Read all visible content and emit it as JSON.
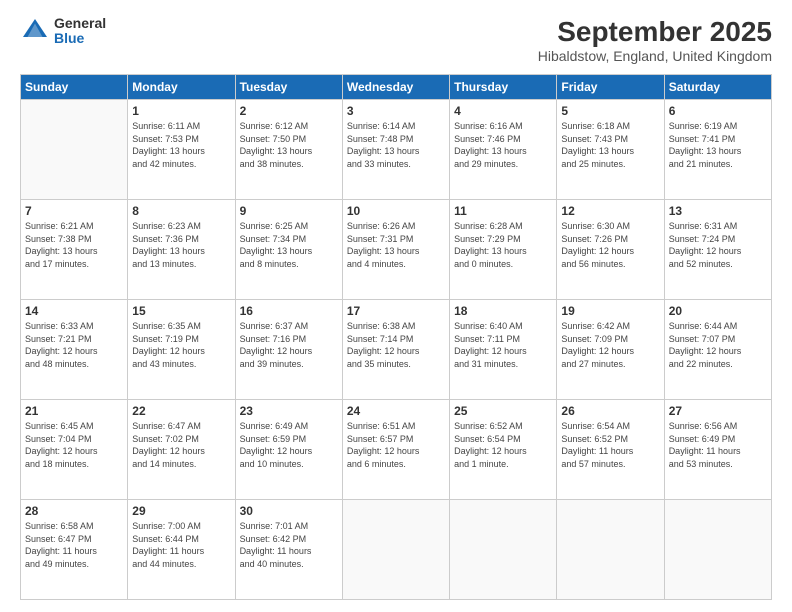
{
  "header": {
    "logo": {
      "general": "General",
      "blue": "Blue"
    },
    "title": "September 2025",
    "subtitle": "Hibaldstow, England, United Kingdom"
  },
  "calendar": {
    "days_of_week": [
      "Sunday",
      "Monday",
      "Tuesday",
      "Wednesday",
      "Thursday",
      "Friday",
      "Saturday"
    ],
    "weeks": [
      [
        {
          "day": "",
          "info": ""
        },
        {
          "day": "1",
          "info": "Sunrise: 6:11 AM\nSunset: 7:53 PM\nDaylight: 13 hours\nand 42 minutes."
        },
        {
          "day": "2",
          "info": "Sunrise: 6:12 AM\nSunset: 7:50 PM\nDaylight: 13 hours\nand 38 minutes."
        },
        {
          "day": "3",
          "info": "Sunrise: 6:14 AM\nSunset: 7:48 PM\nDaylight: 13 hours\nand 33 minutes."
        },
        {
          "day": "4",
          "info": "Sunrise: 6:16 AM\nSunset: 7:46 PM\nDaylight: 13 hours\nand 29 minutes."
        },
        {
          "day": "5",
          "info": "Sunrise: 6:18 AM\nSunset: 7:43 PM\nDaylight: 13 hours\nand 25 minutes."
        },
        {
          "day": "6",
          "info": "Sunrise: 6:19 AM\nSunset: 7:41 PM\nDaylight: 13 hours\nand 21 minutes."
        }
      ],
      [
        {
          "day": "7",
          "info": "Sunrise: 6:21 AM\nSunset: 7:38 PM\nDaylight: 13 hours\nand 17 minutes."
        },
        {
          "day": "8",
          "info": "Sunrise: 6:23 AM\nSunset: 7:36 PM\nDaylight: 13 hours\nand 13 minutes."
        },
        {
          "day": "9",
          "info": "Sunrise: 6:25 AM\nSunset: 7:34 PM\nDaylight: 13 hours\nand 8 minutes."
        },
        {
          "day": "10",
          "info": "Sunrise: 6:26 AM\nSunset: 7:31 PM\nDaylight: 13 hours\nand 4 minutes."
        },
        {
          "day": "11",
          "info": "Sunrise: 6:28 AM\nSunset: 7:29 PM\nDaylight: 13 hours\nand 0 minutes."
        },
        {
          "day": "12",
          "info": "Sunrise: 6:30 AM\nSunset: 7:26 PM\nDaylight: 12 hours\nand 56 minutes."
        },
        {
          "day": "13",
          "info": "Sunrise: 6:31 AM\nSunset: 7:24 PM\nDaylight: 12 hours\nand 52 minutes."
        }
      ],
      [
        {
          "day": "14",
          "info": "Sunrise: 6:33 AM\nSunset: 7:21 PM\nDaylight: 12 hours\nand 48 minutes."
        },
        {
          "day": "15",
          "info": "Sunrise: 6:35 AM\nSunset: 7:19 PM\nDaylight: 12 hours\nand 43 minutes."
        },
        {
          "day": "16",
          "info": "Sunrise: 6:37 AM\nSunset: 7:16 PM\nDaylight: 12 hours\nand 39 minutes."
        },
        {
          "day": "17",
          "info": "Sunrise: 6:38 AM\nSunset: 7:14 PM\nDaylight: 12 hours\nand 35 minutes."
        },
        {
          "day": "18",
          "info": "Sunrise: 6:40 AM\nSunset: 7:11 PM\nDaylight: 12 hours\nand 31 minutes."
        },
        {
          "day": "19",
          "info": "Sunrise: 6:42 AM\nSunset: 7:09 PM\nDaylight: 12 hours\nand 27 minutes."
        },
        {
          "day": "20",
          "info": "Sunrise: 6:44 AM\nSunset: 7:07 PM\nDaylight: 12 hours\nand 22 minutes."
        }
      ],
      [
        {
          "day": "21",
          "info": "Sunrise: 6:45 AM\nSunset: 7:04 PM\nDaylight: 12 hours\nand 18 minutes."
        },
        {
          "day": "22",
          "info": "Sunrise: 6:47 AM\nSunset: 7:02 PM\nDaylight: 12 hours\nand 14 minutes."
        },
        {
          "day": "23",
          "info": "Sunrise: 6:49 AM\nSunset: 6:59 PM\nDaylight: 12 hours\nand 10 minutes."
        },
        {
          "day": "24",
          "info": "Sunrise: 6:51 AM\nSunset: 6:57 PM\nDaylight: 12 hours\nand 6 minutes."
        },
        {
          "day": "25",
          "info": "Sunrise: 6:52 AM\nSunset: 6:54 PM\nDaylight: 12 hours\nand 1 minute."
        },
        {
          "day": "26",
          "info": "Sunrise: 6:54 AM\nSunset: 6:52 PM\nDaylight: 11 hours\nand 57 minutes."
        },
        {
          "day": "27",
          "info": "Sunrise: 6:56 AM\nSunset: 6:49 PM\nDaylight: 11 hours\nand 53 minutes."
        }
      ],
      [
        {
          "day": "28",
          "info": "Sunrise: 6:58 AM\nSunset: 6:47 PM\nDaylight: 11 hours\nand 49 minutes."
        },
        {
          "day": "29",
          "info": "Sunrise: 7:00 AM\nSunset: 6:44 PM\nDaylight: 11 hours\nand 44 minutes."
        },
        {
          "day": "30",
          "info": "Sunrise: 7:01 AM\nSunset: 6:42 PM\nDaylight: 11 hours\nand 40 minutes."
        },
        {
          "day": "",
          "info": ""
        },
        {
          "day": "",
          "info": ""
        },
        {
          "day": "",
          "info": ""
        },
        {
          "day": "",
          "info": ""
        }
      ]
    ]
  }
}
